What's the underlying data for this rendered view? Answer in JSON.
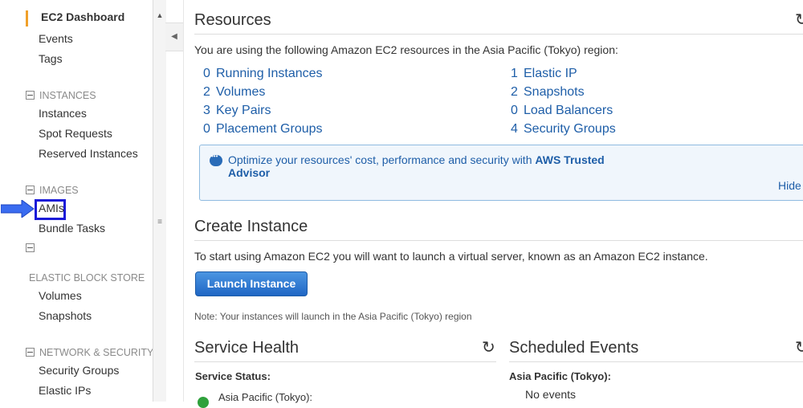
{
  "sidebar": {
    "dashboard": "EC2 Dashboard",
    "top_items": [
      "Events",
      "Tags"
    ],
    "sections": {
      "instances": {
        "title": "INSTANCES",
        "items": [
          "Instances",
          "Spot Requests",
          "Reserved Instances"
        ]
      },
      "images": {
        "title": "IMAGES",
        "items": [
          "AMIs",
          "Bundle Tasks"
        ]
      },
      "ebs": {
        "title": "ELASTIC BLOCK STORE",
        "items": [
          "Volumes",
          "Snapshots"
        ]
      },
      "network": {
        "title": "NETWORK & SECURITY",
        "items": [
          "Security Groups",
          "Elastic IPs"
        ]
      }
    },
    "highlight_color": "#1a1ad8",
    "arrow_color": "#3a6cf0"
  },
  "resources": {
    "title": "Resources",
    "intro": "You are using the following Amazon EC2 resources in the Asia Pacific (Tokyo) region:",
    "left": [
      {
        "count": "0",
        "label": "Running Instances"
      },
      {
        "count": "2",
        "label": "Volumes"
      },
      {
        "count": "3",
        "label": "Key Pairs"
      },
      {
        "count": "0",
        "label": "Placement Groups"
      }
    ],
    "right": [
      {
        "count": "1",
        "label": "Elastic IP"
      },
      {
        "count": "2",
        "label": "Snapshots"
      },
      {
        "count": "0",
        "label": "Load Balancers"
      },
      {
        "count": "4",
        "label": "Security Groups"
      }
    ],
    "info": {
      "text": "Optimize your resources' cost, performance and security with",
      "link_1": "AWS Trusted",
      "link_2": "Advisor",
      "hide": "Hide"
    }
  },
  "create_instance": {
    "title": "Create Instance",
    "text": "To start using Amazon EC2 you will want to launch a virtual server, known as an Amazon EC2 instance.",
    "button": "Launch Instance",
    "note": "Note: Your instances will launch in the Asia Pacific (Tokyo) region"
  },
  "service_health": {
    "title": "Service Health",
    "status_label": "Service Status:",
    "region": "Asia Pacific (Tokyo):"
  },
  "scheduled_events": {
    "title": "Scheduled Events",
    "region": "Asia Pacific (Tokyo):",
    "value": "No events"
  },
  "icons": {
    "refresh": "↻",
    "collapse": "◀",
    "scroll_up": "▲",
    "grip": "≡"
  },
  "colors": {
    "link": "#1e5ea8",
    "accent": "#f0a02a",
    "button": "#1f66c4"
  }
}
